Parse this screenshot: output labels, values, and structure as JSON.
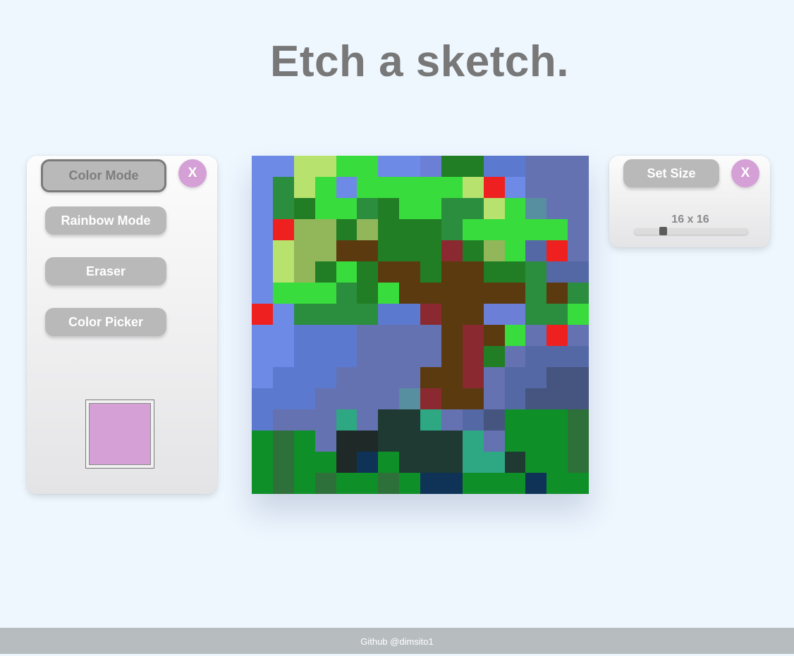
{
  "title": "Etch a sketch.",
  "left_panel": {
    "buttons": {
      "color_mode": "Color Mode",
      "rainbow_mode": "Rainbow Mode",
      "eraser": "Eraser",
      "color_picker": "Color Picker"
    },
    "close_label": "X",
    "current_color": "#d4a0d6"
  },
  "right_panel": {
    "set_size_label": "Set Size",
    "close_label": "X",
    "size_label": "16 x 16",
    "grid_size": 16,
    "slider": {
      "min": 1,
      "max": 64,
      "value": 16
    }
  },
  "canvas": {
    "grid_size": 16,
    "palette": {
      "B": "#6d8ae6",
      "b": "#5c79d0",
      "c": "#6b7fd6",
      "n": "#6472b2",
      "N": "#5568a6",
      "D": "#465480",
      "L": "#b8e26e",
      "O": "#92b65a",
      "G": "#38dc3c",
      "g": "#2b8d3e",
      "F": "#217e25",
      "f": "#2a8a3c",
      "H": "#0f8f27",
      "V": "#2e7039",
      "K": "#1f3933",
      "k": "#1f2a28",
      "T": "#2ea783",
      "Y": "#0e3357",
      "W": "#5c3a0f",
      "M": "#8a2a30",
      "R": "#ef2020",
      "Q": "#588fa0"
    },
    "rows": [
      "BBLLGGBBcFFbbnnn",
      "BgLGBGGGGGLRBnnn",
      "BgFGGgFGGggLGQnn",
      "BROOFOFFFgGGGGGn",
      "BLOOWWFFFMFOGNRn",
      "BLOFGFWWFWWFFgN",
      "BGGGgFGWWWWWWgWg",
      "RBggggbbMWWccggG",
      "BBbbbnnnnWMWGnRn",
      "BBbbbnnnnWMFnNNN",
      "BbbbnnnnWWMnNNDD",
      "bbbnnnnQMWWnNDDD",
      "bnnnTnKKTnNDHHHV",
      "HVHnkkKKKKTnHHHV",
      "HVHHkYHKKKTTKHHV",
      "HVHVHHVHYYHHHYHH"
    ]
  },
  "footer": "Github @dimsito1"
}
